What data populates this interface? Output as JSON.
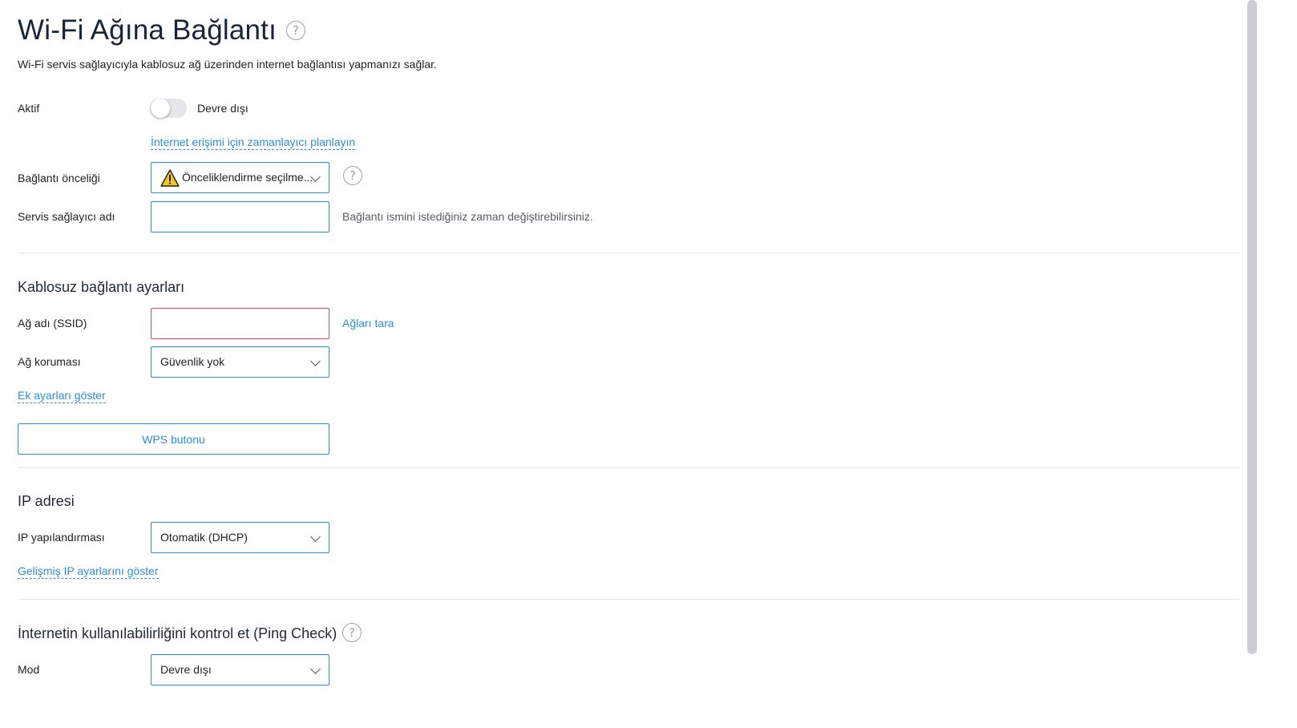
{
  "header": {
    "title": "Wi-Fi Ağına Bağlantı",
    "subtitle": "Wi-Fi servis sağlayıcıyla kablosuz ağ üzerinden internet bağlantısı yapmanızı sağlar.",
    "help_glyph": "?"
  },
  "general": {
    "active_label": "Aktif",
    "active_state": "Devre dışı",
    "active_on": false,
    "schedule_link": "İnternet erişimi için zamanlayıcı planlayın",
    "priority_label": "Bağlantı önceliği",
    "priority_value": "Önceliklendirme seçilme...",
    "priority_icon": "warning-icon",
    "provider_label": "Servis sağlayıcı adı",
    "provider_value": "",
    "provider_hint": "Bağlantı ismini istediğiniz zaman değiştirebilirsiniz."
  },
  "wireless": {
    "section_title": "Kablosuz bağlantı ayarları",
    "ssid_label": "Ağ adı (SSID)",
    "ssid_value": "",
    "scan_link": "Ağları tara",
    "protection_label": "Ağ koruması",
    "protection_value": "Güvenlik yok",
    "more_settings_link": "Ek ayarları göster",
    "wps_button": "WPS butonu"
  },
  "ip": {
    "section_title": "IP adresi",
    "config_label": "IP yapılandırması",
    "config_value": "Otomatik (DHCP)",
    "advanced_link": "Gelişmiş IP ayarlarını göster"
  },
  "ping": {
    "section_title": "İnternetin kullanılabilirliğini kontrol et (Ping Check)",
    "mode_label": "Mod",
    "mode_value": "Devre dışı"
  },
  "colors": {
    "accent": "#2b8fd6",
    "error_border": "#e0485a",
    "warning": "#f5c518"
  }
}
